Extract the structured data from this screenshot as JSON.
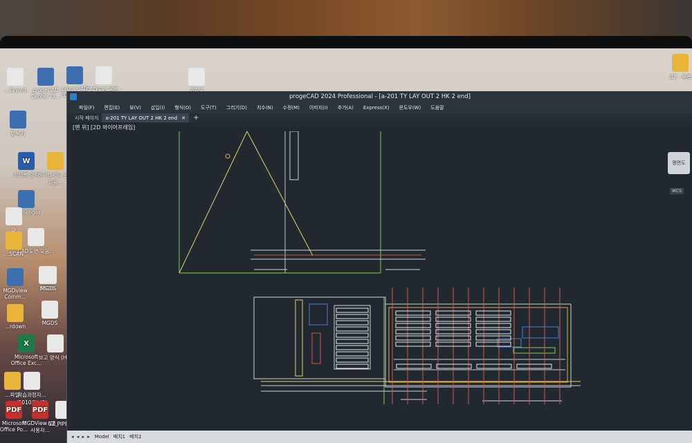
{
  "desktop": {
    "icons": [
      {
        "label": "...ilayout",
        "type": "doc"
      },
      {
        "label": "progeCAD Center Cl...",
        "type": "app"
      },
      {
        "label": "progeCAD 2024 Pro...",
        "type": "app"
      },
      {
        "label": "CAD도면 목록 - 바로가기",
        "type": "doc"
      },
      {
        "label": "2024",
        "type": "doc"
      },
      {
        "label": "GZ - 목록",
        "type": "folder"
      },
      {
        "label": "탐색기",
        "type": "app"
      },
      {
        "label": "회의록 양식",
        "type": "word"
      },
      {
        "label": "하이브리드 관련 자료...",
        "type": "folder"
      },
      {
        "label": "Messenger",
        "type": "app"
      },
      {
        "label": "마",
        "type": "doc"
      },
      {
        "label": "CAD도면 모음...",
        "type": "doc"
      },
      {
        "label": "MSDS",
        "type": "doc"
      },
      {
        "label": "...SCAN",
        "type": "folder"
      },
      {
        "label": "MGDview Comm...",
        "type": "app"
      },
      {
        "label": "MGDS",
        "type": "doc"
      },
      {
        "label": "...rdown",
        "type": "folder"
      },
      {
        "label": "MGDS",
        "type": "doc"
      },
      {
        "label": "Microsoft Office Exc...",
        "type": "excel"
      },
      {
        "label": "보고 양식 (HK)",
        "type": "doc"
      },
      {
        "label": "...파일",
        "type": "folder"
      },
      {
        "label": "학습과정자... (2010용) (1)",
        "type": "doc"
      },
      {
        "label": "Microsoft Office Po...",
        "type": "pdf"
      },
      {
        "label": "MGDView V8_사용자...",
        "type": "pdf"
      },
      {
        "label": "GZ PIPE 규격",
        "type": "doc"
      }
    ]
  },
  "window": {
    "title": "progeCAD 2024 Professional - [a-201 TY LAY OUT 2 HK 2 end]",
    "menu": [
      "파일(F)",
      "편집(E)",
      "뷰(V)",
      "삽입(I)",
      "형식(O)",
      "도구(T)",
      "그리기(D)",
      "치수(N)",
      "수정(M)",
      "이미지(I)",
      "추가(A)",
      "Express(X)",
      "윈도우(W)",
      "도움말"
    ],
    "tabs": [
      {
        "label": "시작 페이지",
        "active": false
      },
      {
        "label": "a-201 TY LAY OUT 2 HK 2 end",
        "active": true
      }
    ],
    "view_label": "[맨 위] [2D 와이어프레임]",
    "navcube_label": "평면도",
    "wcs_label": "WCS",
    "status": {
      "nav": "◂ ◂ ▸ ▸",
      "model_tab": "Model",
      "layout1": "배치1",
      "layout2": "배치2"
    }
  },
  "colors": {
    "canvas": "#212830",
    "accent": "#2f7fd0"
  }
}
